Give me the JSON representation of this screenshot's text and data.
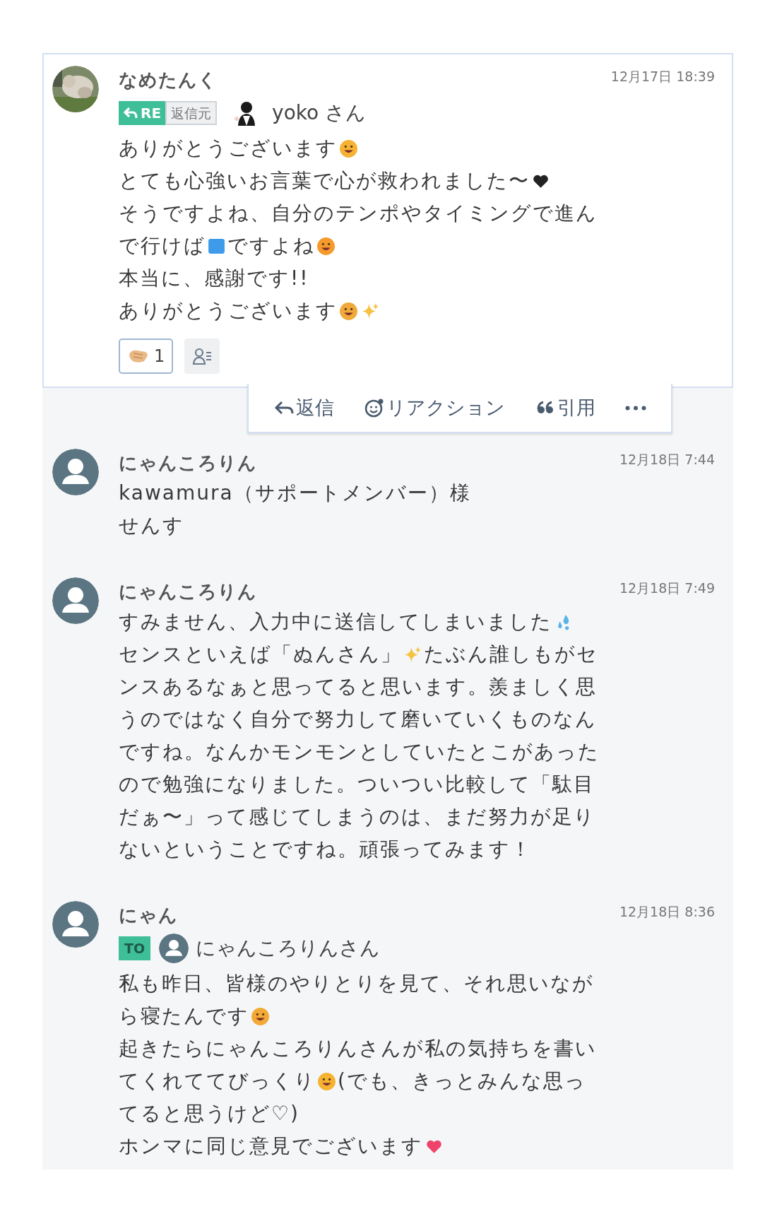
{
  "messages": [
    {
      "author": "なめたんく",
      "time": "12月17日 18:39",
      "avatar": {
        "kind": "picture"
      },
      "hovered": true,
      "address": {
        "kind": "reply",
        "tag": "RE",
        "source": "返信元",
        "name": "yoko さん"
      },
      "lines": [
        [
          {
            "kind": "text",
            "text": "ありがとうございます"
          },
          {
            "kind": "face",
            "color": "#f6b231"
          }
        ],
        [
          {
            "kind": "text",
            "text": "とても心強いお言葉で心が救われました〜"
          },
          {
            "kind": "heart",
            "color": "#222222"
          }
        ],
        [
          {
            "kind": "text",
            "text": "そうですよね、自分のテンポやタイミングで進ん"
          }
        ],
        [
          {
            "kind": "text",
            "text": "で行けば"
          },
          {
            "kind": "tile",
            "color": "#3d9be9"
          },
          {
            "kind": "text",
            "text": "ですよね"
          },
          {
            "kind": "face",
            "color": "#f59a2c"
          }
        ],
        [
          {
            "kind": "text",
            "text": "本当に、感謝です!!"
          }
        ],
        [
          {
            "kind": "text",
            "text": "ありがとうございます"
          },
          {
            "kind": "face",
            "color": "#f0a93a"
          },
          {
            "kind": "sparkle",
            "color": "#f5c243"
          }
        ]
      ],
      "reactions": {
        "items": [
          {
            "count": "1"
          }
        ],
        "members_button": true
      }
    },
    {
      "author": "にゃんころりん",
      "time": "12月18日 7:44",
      "avatar": {
        "kind": "default"
      },
      "hovered": false,
      "lines": [
        [
          {
            "kind": "text",
            "text": "kawamura（サポートメンバー）様"
          }
        ],
        [
          {
            "kind": "text",
            "text": "せんす"
          }
        ]
      ]
    },
    {
      "author": "にゃんころりん",
      "time": "12月18日 7:49",
      "avatar": {
        "kind": "default"
      },
      "hovered": false,
      "lines": [
        [
          {
            "kind": "text",
            "text": "すみません、入力中に送信してしまいました"
          },
          {
            "kind": "drops",
            "color": "#5ab4e8"
          }
        ],
        [
          {
            "kind": "text",
            "text": "センスといえば「ぬんさん」"
          },
          {
            "kind": "sparkle",
            "color": "#f5c243"
          },
          {
            "kind": "text",
            "text": "たぶん誰しもがセ"
          }
        ],
        [
          {
            "kind": "text",
            "text": "ンスあるなぁと思ってると思います。羨ましく思"
          }
        ],
        [
          {
            "kind": "text",
            "text": "うのではなく自分で努力して磨いていくものなん"
          }
        ],
        [
          {
            "kind": "text",
            "text": "ですね。なんかモンモンとしていたとこがあった"
          }
        ],
        [
          {
            "kind": "text",
            "text": "ので勉強になりました。ついつい比較して「駄目"
          }
        ],
        [
          {
            "kind": "text",
            "text": "だぁ〜」って感じてしまうのは、まだ努力が足り"
          }
        ],
        [
          {
            "kind": "text",
            "text": "ないということですね。頑張ってみます！"
          }
        ]
      ]
    },
    {
      "author": "にゃん",
      "time": "12月18日 8:36",
      "avatar": {
        "kind": "default"
      },
      "hovered": false,
      "address": {
        "kind": "to",
        "tag": "TO",
        "name": "にゃんころりんさん"
      },
      "lines": [
        [
          {
            "kind": "text",
            "text": "私も昨日、皆様のやりとりを見て、それ思いなが"
          }
        ],
        [
          {
            "kind": "text",
            "text": "ら寝たんです"
          },
          {
            "kind": "face",
            "color": "#f3a935"
          }
        ],
        [
          {
            "kind": "text",
            "text": "起きたらにゃんころりんさんが私の気持ちを書い"
          }
        ],
        [
          {
            "kind": "text",
            "text": "てくれててびっくり"
          },
          {
            "kind": "face",
            "color": "#f6b231"
          },
          {
            "kind": "text",
            "text": "(でも、きっとみんな思っ"
          }
        ],
        [
          {
            "kind": "text",
            "text": "てると思うけど♡)"
          }
        ],
        [
          {
            "kind": "text",
            "text": "ホンマに同じ意見でございます"
          },
          {
            "kind": "heart",
            "color": "#f0436a"
          }
        ]
      ]
    }
  ],
  "action_bar": [
    {
      "kind": "reply",
      "label": "返信"
    },
    {
      "kind": "reaction",
      "label": "リアクション"
    },
    {
      "kind": "quote",
      "label": "引用"
    },
    {
      "kind": "more"
    }
  ]
}
